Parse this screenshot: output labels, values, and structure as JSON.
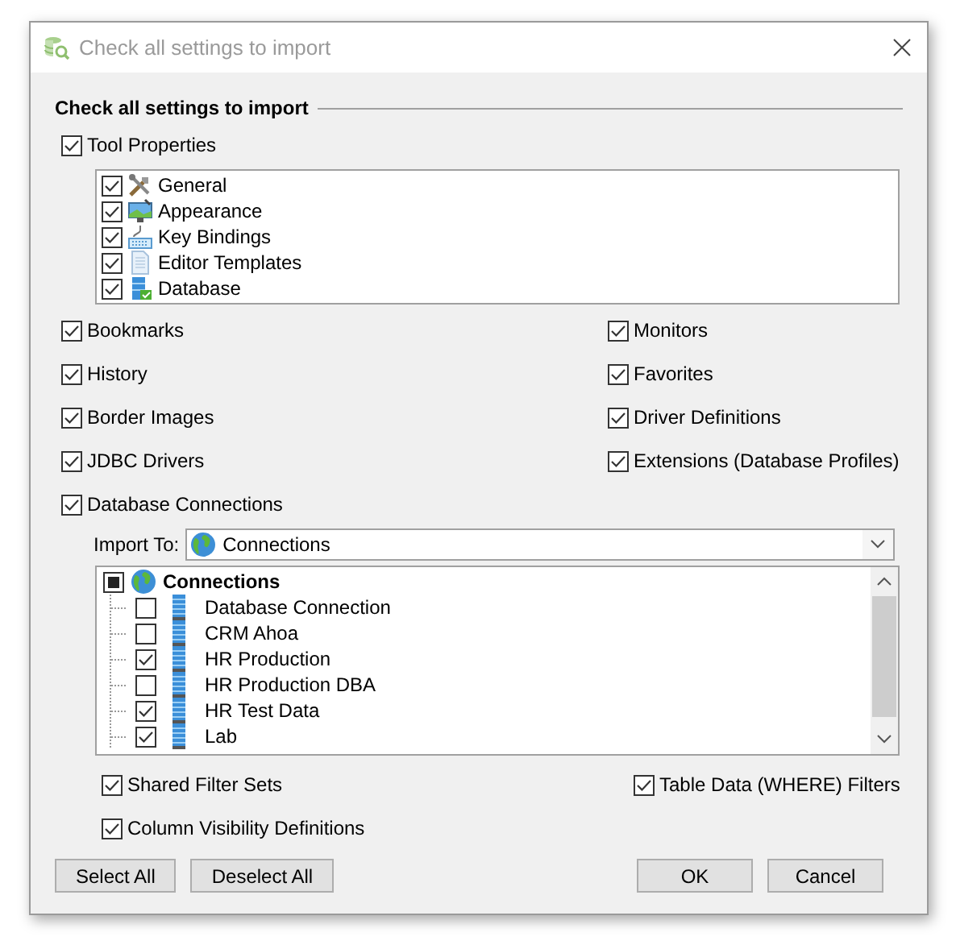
{
  "window": {
    "title": "Check all settings to import"
  },
  "heading": "Check all settings to import",
  "tool_properties": {
    "label": "Tool Properties",
    "checked": true,
    "items": [
      {
        "label": "General",
        "checked": true
      },
      {
        "label": "Appearance",
        "checked": true
      },
      {
        "label": "Key Bindings",
        "checked": true
      },
      {
        "label": "Editor Templates",
        "checked": true
      },
      {
        "label": "Database",
        "checked": true
      }
    ]
  },
  "options": [
    {
      "label": "Bookmarks",
      "checked": true
    },
    {
      "label": "Monitors",
      "checked": true
    },
    {
      "label": "History",
      "checked": true
    },
    {
      "label": "Favorites",
      "checked": true
    },
    {
      "label": "Border Images",
      "checked": true
    },
    {
      "label": "Driver Definitions",
      "checked": true
    },
    {
      "label": "JDBC Drivers",
      "checked": true
    },
    {
      "label": "Extensions (Database Profiles)",
      "checked": true
    }
  ],
  "database_connections": {
    "label": "Database Connections",
    "checked": true,
    "import_to": {
      "label": "Import To:",
      "value": "Connections"
    },
    "tree": {
      "label": "Connections",
      "partial": true,
      "children": [
        {
          "label": "Database Connection",
          "checked": false
        },
        {
          "label": "CRM Ahoa",
          "checked": false
        },
        {
          "label": "HR Production",
          "checked": true
        },
        {
          "label": "HR Production DBA",
          "checked": false
        },
        {
          "label": "HR Test Data",
          "checked": true
        },
        {
          "label": "Lab",
          "checked": true
        }
      ]
    },
    "sub_options": [
      {
        "label": "Shared Filter Sets",
        "checked": true
      },
      {
        "label": "Table Data (WHERE) Filters",
        "checked": true
      },
      {
        "label": "Column Visibility Definitions",
        "checked": true
      }
    ]
  },
  "buttons": {
    "left": [
      {
        "label": "Select All"
      },
      {
        "label": "Deselect All"
      }
    ],
    "right": [
      {
        "label": "OK"
      },
      {
        "label": "Cancel"
      }
    ]
  }
}
